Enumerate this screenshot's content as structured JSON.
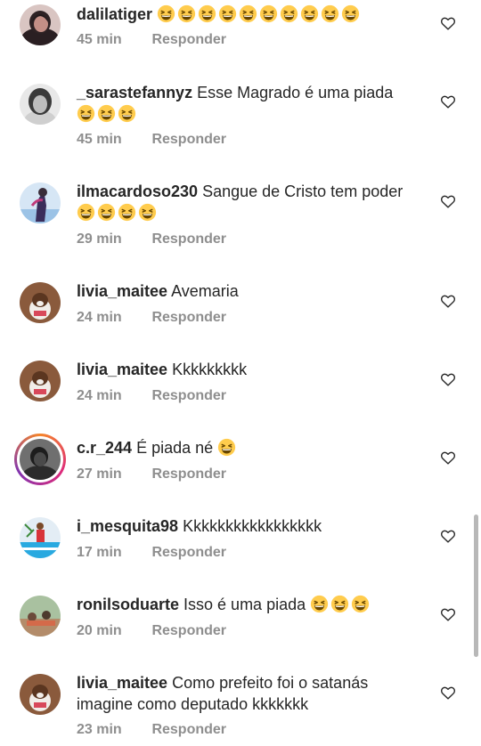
{
  "comments": [
    {
      "username": "dalilatiger",
      "text": "",
      "emoji_count": 10,
      "time": "45 min",
      "reply_label": "Responder"
    },
    {
      "username": "_sarastefannyz",
      "text": "Esse Magrado é uma piada",
      "emoji_count": 3,
      "time": "45 min",
      "reply_label": "Responder"
    },
    {
      "username": "ilmacardoso230",
      "text": "Sangue de Cristo tem poder",
      "emoji_count": 4,
      "time": "29 min",
      "reply_label": "Responder"
    },
    {
      "username": "livia_maitee",
      "text": "Avemaria",
      "emoji_count": 0,
      "time": "24 min",
      "reply_label": "Responder"
    },
    {
      "username": "livia_maitee",
      "text": "Kkkkkkkkk",
      "emoji_count": 0,
      "time": "24 min",
      "reply_label": "Responder"
    },
    {
      "username": "c.r_244",
      "text": "É piada né",
      "emoji_count": 1,
      "time": "27 min",
      "reply_label": "Responder"
    },
    {
      "username": "i_mesquita98",
      "text": "Kkkkkkkkkkkkkkkkk",
      "emoji_count": 0,
      "time": "17 min",
      "reply_label": "Responder"
    },
    {
      "username": "ronilsoduarte",
      "text": "Isso é uma piada",
      "emoji_count": 3,
      "time": "20 min",
      "reply_label": "Responder"
    },
    {
      "username": "livia_maitee",
      "text": "Como prefeito foi o satanás imagine como deputado kkkkkkk",
      "emoji_count": 0,
      "time": "23 min",
      "reply_label": "Responder"
    }
  ],
  "icons": {
    "like": "heart-outline-icon",
    "emoji": "grinning-squinting-face-emoji"
  },
  "colors": {
    "text": "#262626",
    "secondary": "#8e8e8e",
    "background": "#ffffff"
  }
}
